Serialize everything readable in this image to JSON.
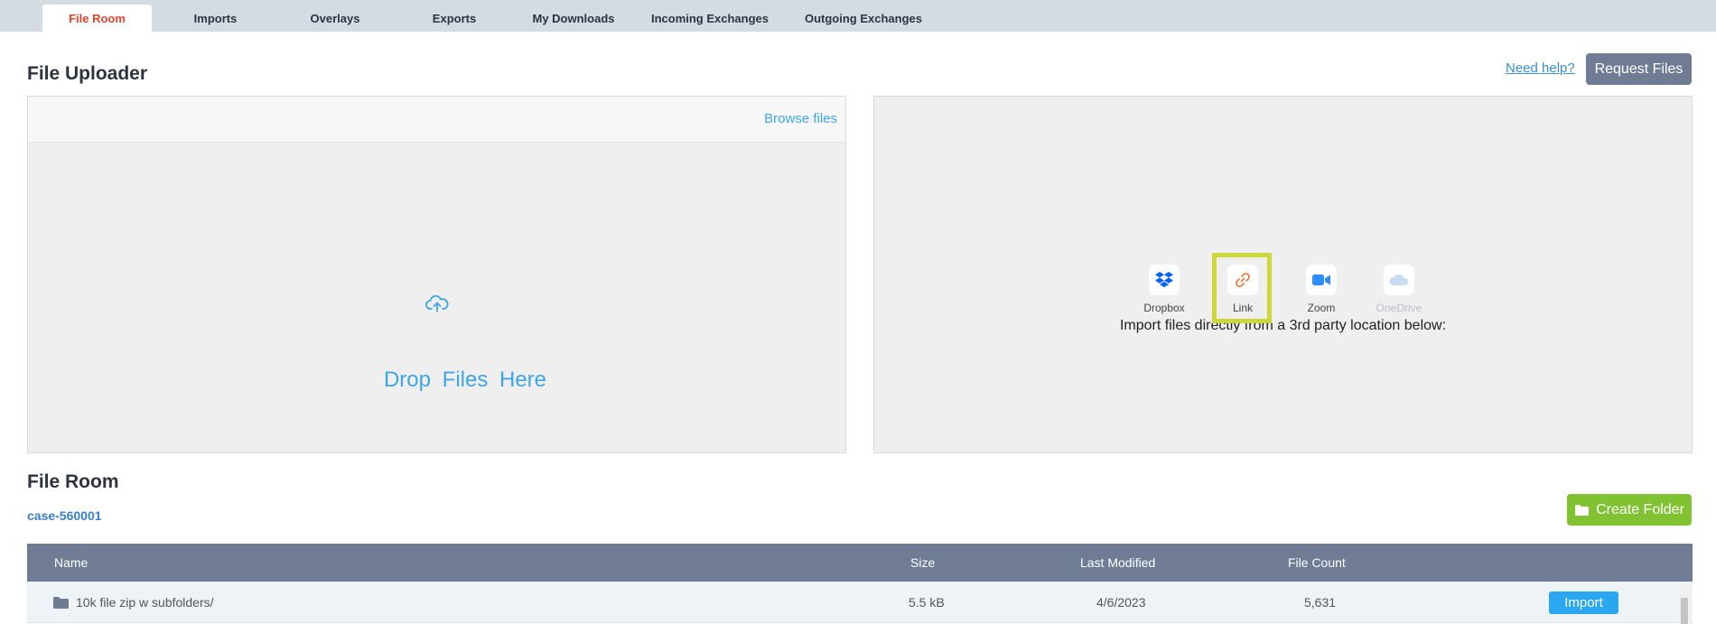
{
  "tabs": [
    {
      "label": "File Room",
      "active": true
    },
    {
      "label": "Imports"
    },
    {
      "label": "Overlays"
    },
    {
      "label": "Exports"
    },
    {
      "label": "My Downloads"
    },
    {
      "label": "Incoming Exchanges"
    },
    {
      "label": "Outgoing Exchanges"
    }
  ],
  "uploader": {
    "title": "File Uploader",
    "browse_label": "Browse files",
    "drop_label": "Drop Files Here",
    "icon": "cloud-upload-icon"
  },
  "header_actions": {
    "help_label": "Need help?",
    "request_label": "Request Files"
  },
  "importer": {
    "prompt": "Import files directly from a 3rd party location below:",
    "sources": [
      {
        "label": "Dropbox",
        "icon": "dropbox-icon",
        "color": "#0061fe"
      },
      {
        "label": "Link",
        "icon": "link-icon",
        "color": "#f07c3a",
        "highlighted": true
      },
      {
        "label": "Zoom",
        "icon": "zoom-icon",
        "color": "#2d8cff"
      },
      {
        "label": "OneDrive",
        "icon": "onedrive-icon",
        "color": "#c7ddf1",
        "disabled": true
      }
    ]
  },
  "file_room": {
    "title": "File Room",
    "breadcrumb": "case-560001",
    "create_folder_label": "Create Folder",
    "columns": [
      "Name",
      "Size",
      "Last Modified",
      "File Count"
    ],
    "rows": [
      {
        "name": "10k file zip w subfolders/",
        "size": "5.5 kB",
        "modified": "4/6/2023",
        "count": "5,631",
        "action": "Import"
      }
    ]
  },
  "colors": {
    "accent_tab": "#e0452b",
    "link_blue": "#3ea6e8",
    "header_gray": "#6f7c93",
    "create_green": "#80c232",
    "highlight": "#ccd83a"
  }
}
